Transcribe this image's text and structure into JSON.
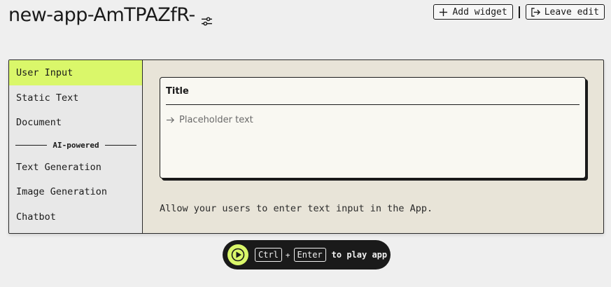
{
  "header": {
    "app_title": "new-app-AmTPAZfR-",
    "add_widget_label": "Add widget",
    "leave_edit_label": "Leave edit"
  },
  "sidebar": {
    "items": [
      {
        "label": "User Input",
        "active": true
      },
      {
        "label": "Static Text"
      },
      {
        "label": "Document"
      }
    ],
    "section_label": "AI-powered",
    "ai_items": [
      {
        "label": "Text Generation"
      },
      {
        "label": "Image Generation"
      },
      {
        "label": "Chatbot"
      }
    ]
  },
  "preview": {
    "title": "Title",
    "placeholder": "Placeholder text",
    "description": "Allow your users to enter text input in the App."
  },
  "play_bar": {
    "key1": "Ctrl",
    "plus": "+",
    "key2": "Enter",
    "label": "to play app"
  },
  "colors": {
    "accent": "#daf76a",
    "background": "#efefef",
    "panel": "#e8e4d8",
    "dark": "#1a1a1a"
  }
}
